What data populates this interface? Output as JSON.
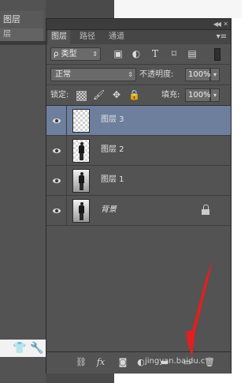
{
  "background_window": {
    "tab_label": "图层",
    "tab2_label": "层"
  },
  "panel": {
    "tabs": [
      {
        "label": "图层",
        "active": true
      },
      {
        "label": "路径",
        "active": false
      },
      {
        "label": "通道",
        "active": false
      }
    ],
    "filter": {
      "kind_label": "ρ 类型",
      "icons": [
        "image-filter-icon",
        "adjustment-filter-icon",
        "type-filter-icon",
        "shape-filter-icon",
        "smart-object-filter-icon"
      ]
    },
    "blend_mode": "正常",
    "opacity_label": "不透明度:",
    "opacity_value": "100%",
    "lock_label": "锁定:",
    "fill_label": "填充:",
    "fill_value": "100%",
    "layers": [
      {
        "name": "图层 3",
        "selected": true,
        "visible": true,
        "thumbnail": "transparent"
      },
      {
        "name": "图层 2",
        "selected": false,
        "visible": true,
        "thumbnail": "figure-on-transparent"
      },
      {
        "name": "图层 1",
        "selected": false,
        "visible": true,
        "thumbnail": "figure-on-photo"
      },
      {
        "name": "背景",
        "selected": false,
        "visible": true,
        "thumbnail": "figure-on-photo",
        "locked": true
      }
    ],
    "bottom_bar": {
      "icons": [
        "link-layers-icon",
        "fx-icon",
        "add-mask-icon",
        "adjustment-layer-icon",
        "new-group-icon",
        "new-layer-icon",
        "trash-icon"
      ],
      "fx_label": "fx",
      "watermark": "jingyan.baidu.c"
    }
  },
  "annotation": {
    "arrow_color": "#e02020"
  },
  "colors": {
    "panel_bg": "#535353",
    "selected_row": "#6e7e9d"
  }
}
